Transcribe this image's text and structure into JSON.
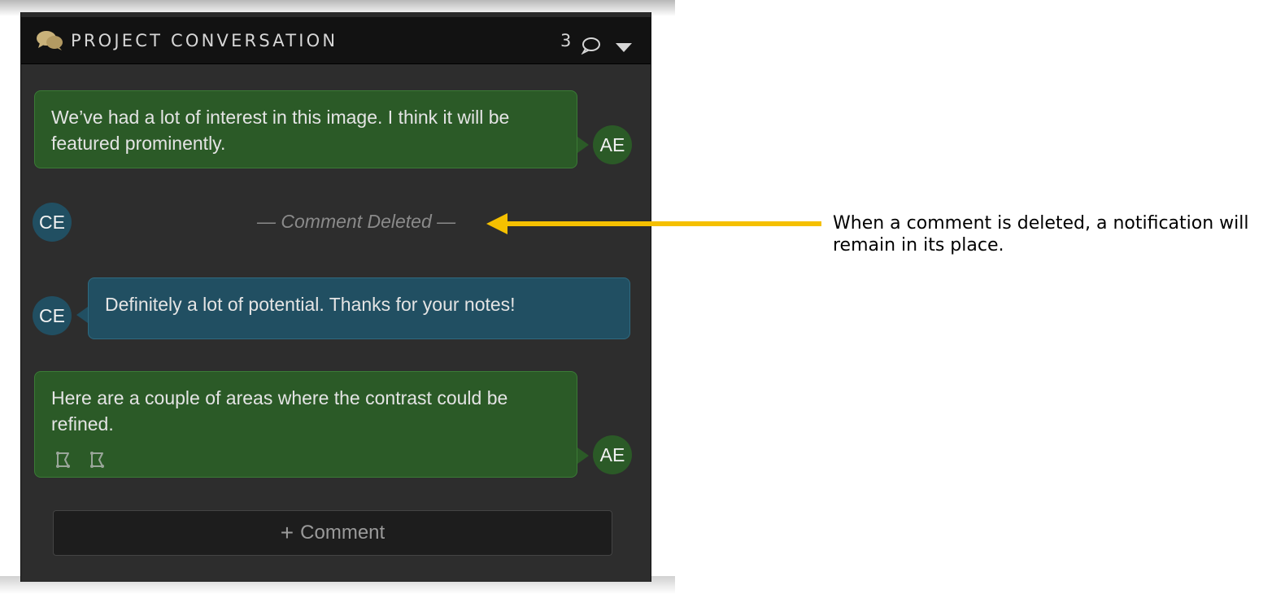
{
  "header": {
    "title": "PROJECT CONVERSATION",
    "comment_count": "3",
    "icons": [
      "chat-bubbles-icon",
      "speech-bubble-icon",
      "chevron-down-icon"
    ]
  },
  "messages": [
    {
      "author_initials": "AE",
      "text": "We’ve had a lot of interest in this image. I think it will be featured prominently.",
      "color": "#2b5a27",
      "side": "right"
    },
    {
      "author_initials": "CE",
      "deleted_text": "— Comment Deleted —",
      "color": "#214f62",
      "side": "left"
    },
    {
      "author_initials": "CE",
      "text": "Definitely a lot of potential. Thanks for your notes!",
      "color": "#214f62",
      "side": "left"
    },
    {
      "author_initials": "AE",
      "text": "Here are a couple of areas where the contrast could be refined.",
      "color": "#2b5a27",
      "side": "right",
      "attachments": [
        "region-marker-icon",
        "region-marker-icon"
      ]
    }
  ],
  "comment_button": {
    "label": "Comment",
    "icon": "plus-icon"
  },
  "annotation": {
    "text": "When a comment is deleted, a notification will remain in its place.",
    "arrow_color": "#f5c000"
  }
}
